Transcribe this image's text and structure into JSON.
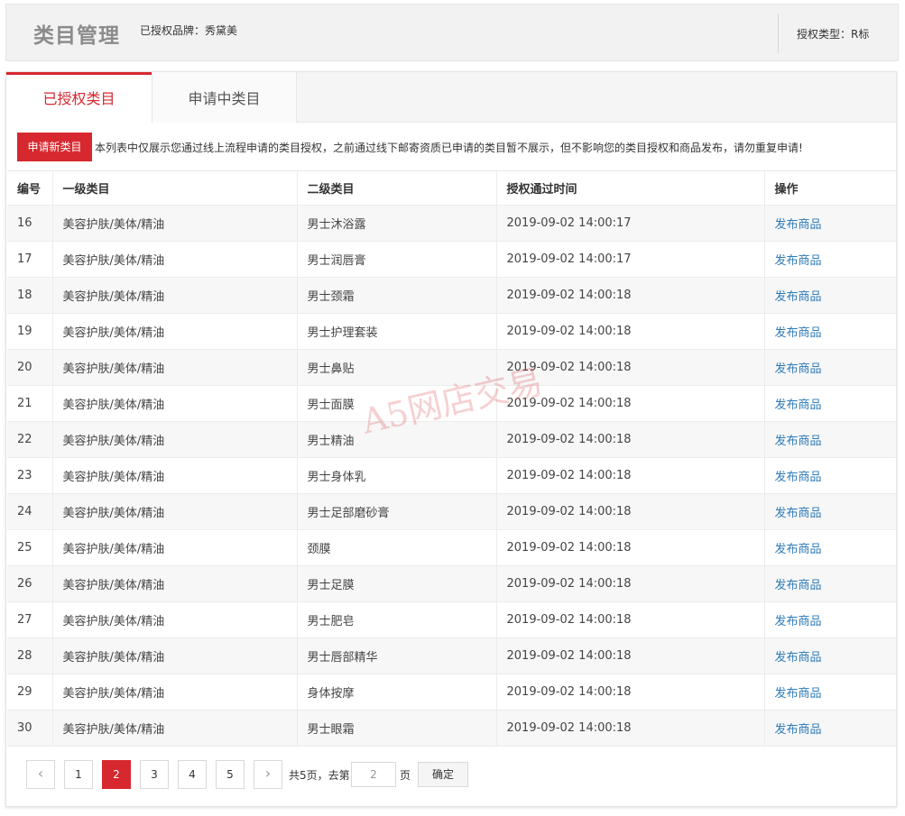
{
  "header": {
    "title": "类目管理",
    "brand_label": "已授权品牌：秀黛美",
    "auth_type_label": "授权类型：R标"
  },
  "tabs": [
    {
      "label": "已授权类目",
      "active": true
    },
    {
      "label": "申请中类目",
      "active": false
    }
  ],
  "notice": {
    "apply_button": "申请新类目",
    "text": "本列表中仅展示您通过线上流程申请的类目授权，之前通过线下邮寄资质已申请的类目暂不展示，但不影响您的类目授权和商品发布，请勿重复申请!"
  },
  "table": {
    "headers": [
      "编号",
      "一级类目",
      "二级类目",
      "授权通过时间",
      "操作"
    ],
    "rows": [
      {
        "id": "16",
        "level1": "美容护肤/美体/精油",
        "level2": "男士沐浴露",
        "time": "2019-09-02 14:00:17",
        "action": "发布商品"
      },
      {
        "id": "17",
        "level1": "美容护肤/美体/精油",
        "level2": "男士润唇膏",
        "time": "2019-09-02 14:00:17",
        "action": "发布商品"
      },
      {
        "id": "18",
        "level1": "美容护肤/美体/精油",
        "level2": "男士颈霜",
        "time": "2019-09-02 14:00:18",
        "action": "发布商品"
      },
      {
        "id": "19",
        "level1": "美容护肤/美体/精油",
        "level2": "男士护理套装",
        "time": "2019-09-02 14:00:18",
        "action": "发布商品"
      },
      {
        "id": "20",
        "level1": "美容护肤/美体/精油",
        "level2": "男士鼻贴",
        "time": "2019-09-02 14:00:18",
        "action": "发布商品"
      },
      {
        "id": "21",
        "level1": "美容护肤/美体/精油",
        "level2": "男士面膜",
        "time": "2019-09-02 14:00:18",
        "action": "发布商品"
      },
      {
        "id": "22",
        "level1": "美容护肤/美体/精油",
        "level2": "男士精油",
        "time": "2019-09-02 14:00:18",
        "action": "发布商品"
      },
      {
        "id": "23",
        "level1": "美容护肤/美体/精油",
        "level2": "男士身体乳",
        "time": "2019-09-02 14:00:18",
        "action": "发布商品"
      },
      {
        "id": "24",
        "level1": "美容护肤/美体/精油",
        "level2": "男士足部磨砂膏",
        "time": "2019-09-02 14:00:18",
        "action": "发布商品"
      },
      {
        "id": "25",
        "level1": "美容护肤/美体/精油",
        "level2": "颈膜",
        "time": "2019-09-02 14:00:18",
        "action": "发布商品"
      },
      {
        "id": "26",
        "level1": "美容护肤/美体/精油",
        "level2": "男士足膜",
        "time": "2019-09-02 14:00:18",
        "action": "发布商品"
      },
      {
        "id": "27",
        "level1": "美容护肤/美体/精油",
        "level2": "男士肥皂",
        "time": "2019-09-02 14:00:18",
        "action": "发布商品"
      },
      {
        "id": "28",
        "level1": "美容护肤/美体/精油",
        "level2": "男士唇部精华",
        "time": "2019-09-02 14:00:18",
        "action": "发布商品"
      },
      {
        "id": "29",
        "level1": "美容护肤/美体/精油",
        "level2": "身体按摩",
        "time": "2019-09-02 14:00:18",
        "action": "发布商品"
      },
      {
        "id": "30",
        "level1": "美容护肤/美体/精油",
        "level2": "男士眼霜",
        "time": "2019-09-02 14:00:18",
        "action": "发布商品"
      }
    ]
  },
  "pagination": {
    "prev_icon": "chevron-left-icon",
    "next_icon": "chevron-right-icon",
    "pages": [
      "1",
      "2",
      "3",
      "4",
      "5"
    ],
    "current_page": "2",
    "total_label": "共5页，去第",
    "input_value": "2",
    "unit_label": "页",
    "confirm_label": "确定"
  },
  "watermark": "A5网店交易",
  "colors": {
    "accent": "#d7282f",
    "link": "#2d7bb8",
    "header_bg": "#f2f2f2"
  }
}
